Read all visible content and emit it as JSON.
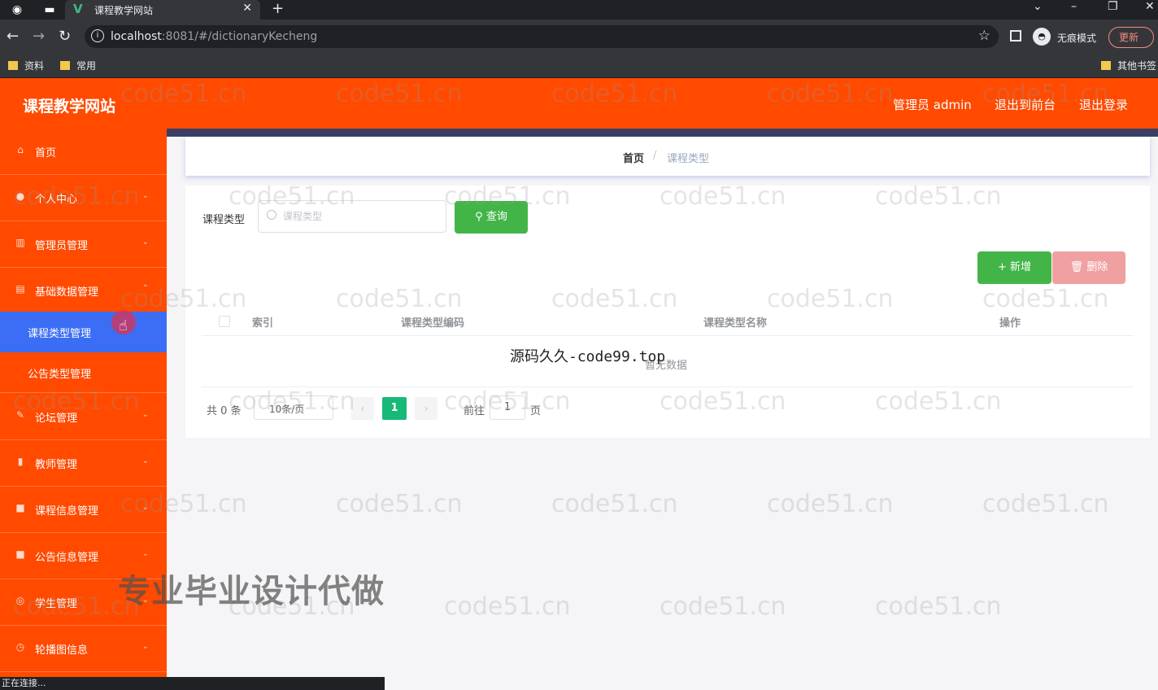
{
  "browser": {
    "tab_title": "课程教学网站",
    "url_host": "localhost",
    "url_rest": ":8081/#/dictionaryKecheng",
    "incognito_label": "无痕模式",
    "update_label": "更新",
    "bookmarks": [
      "资料",
      "常用"
    ],
    "other_bookmarks": "其他书签",
    "status_text": "正在连接..."
  },
  "header": {
    "title": "课程教学网站",
    "user": "管理员 admin",
    "front": "退出到前台",
    "logout": "退出登录"
  },
  "sidebar": {
    "items": [
      {
        "label": "首页",
        "icon": "home-icon"
      },
      {
        "label": "个人中心",
        "icon": "user-icon"
      },
      {
        "label": "管理员管理",
        "icon": "admin-icon"
      },
      {
        "label": "基础数据管理",
        "icon": "data-icon"
      }
    ],
    "submenu": [
      {
        "label": "课程类型管理"
      },
      {
        "label": "公告类型管理"
      }
    ],
    "items2": [
      {
        "label": "论坛管理",
        "icon": "forum-icon"
      },
      {
        "label": "教师管理",
        "icon": "chart-icon"
      },
      {
        "label": "课程信息管理",
        "icon": "course-icon"
      },
      {
        "label": "公告信息管理",
        "icon": "notice-icon"
      },
      {
        "label": "学生管理",
        "icon": "student-icon"
      },
      {
        "label": "轮播图信息",
        "icon": "carousel-icon"
      }
    ]
  },
  "breadcrumb": {
    "home": "首页",
    "current": "课程类型"
  },
  "filter": {
    "label": "课程类型",
    "placeholder": "课程类型",
    "query_button": "查询"
  },
  "actions": {
    "add": "新增",
    "delete": "删除"
  },
  "table": {
    "columns": [
      "索引",
      "课程类型编码",
      "课程类型名称",
      "操作"
    ],
    "empty_text": "暂无数据"
  },
  "pagination": {
    "total": "共 0 条",
    "page_size": "10条/页",
    "current_page": "1",
    "goto_label": "前往",
    "goto_value": "1",
    "page_unit": "页"
  },
  "watermarks": {
    "site": "code51.cn",
    "mid": "源码久久-code99.top",
    "big": "专业毕业设计代做"
  },
  "colors": {
    "header": "#ff4a00",
    "sidebar": "#ff4a00",
    "submenu_active": "#3b6ef5",
    "success": "#43b548",
    "danger_light": "#f0a0a0",
    "page_active": "#17b978"
  }
}
